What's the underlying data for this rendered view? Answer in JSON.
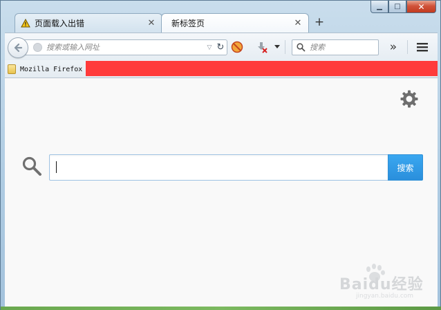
{
  "window": {
    "minimize_glyph": "▁",
    "maximize_glyph": "□",
    "close_glyph": "✕"
  },
  "tabs": [
    {
      "label": "页面载入出错",
      "icon": "warning-icon",
      "active": false
    },
    {
      "label": "新标签页",
      "icon": null,
      "active": true
    }
  ],
  "tab_close_glyph": "✕",
  "new_tab_glyph": "+",
  "navbar": {
    "url_placeholder": "搜索或输入网址",
    "search_placeholder": "搜索",
    "overflow_glyph": "»",
    "menu_icon": "hamburger-menu-icon",
    "reload_glyph": "↻",
    "dropdown_glyph": "▽"
  },
  "bookmarks": [
    {
      "label": "Mozilla Firefox",
      "icon": "folder-icon"
    }
  ],
  "content": {
    "search_button_label": "搜索",
    "settings_icon": "gear-icon"
  },
  "watermark": {
    "text": "Baidu经验",
    "sub": "jingyan.baidu.com"
  },
  "colors": {
    "accent": "#2a8fdc",
    "redaction": "#ff3b3b",
    "content_bg": "#f9f9f9"
  }
}
